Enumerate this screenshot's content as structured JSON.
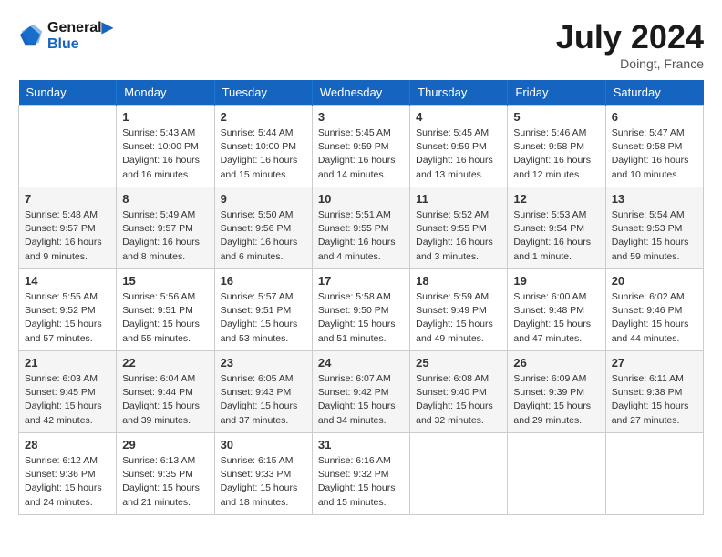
{
  "header": {
    "logo_line1": "General",
    "logo_line2": "Blue",
    "month": "July 2024",
    "location": "Doingt, France"
  },
  "weekdays": [
    "Sunday",
    "Monday",
    "Tuesday",
    "Wednesday",
    "Thursday",
    "Friday",
    "Saturday"
  ],
  "weeks": [
    [
      {
        "day": "",
        "info": ""
      },
      {
        "day": "1",
        "info": "Sunrise: 5:43 AM\nSunset: 10:00 PM\nDaylight: 16 hours\nand 16 minutes."
      },
      {
        "day": "2",
        "info": "Sunrise: 5:44 AM\nSunset: 10:00 PM\nDaylight: 16 hours\nand 15 minutes."
      },
      {
        "day": "3",
        "info": "Sunrise: 5:45 AM\nSunset: 9:59 PM\nDaylight: 16 hours\nand 14 minutes."
      },
      {
        "day": "4",
        "info": "Sunrise: 5:45 AM\nSunset: 9:59 PM\nDaylight: 16 hours\nand 13 minutes."
      },
      {
        "day": "5",
        "info": "Sunrise: 5:46 AM\nSunset: 9:58 PM\nDaylight: 16 hours\nand 12 minutes."
      },
      {
        "day": "6",
        "info": "Sunrise: 5:47 AM\nSunset: 9:58 PM\nDaylight: 16 hours\nand 10 minutes."
      }
    ],
    [
      {
        "day": "7",
        "info": "Sunrise: 5:48 AM\nSunset: 9:57 PM\nDaylight: 16 hours\nand 9 minutes."
      },
      {
        "day": "8",
        "info": "Sunrise: 5:49 AM\nSunset: 9:57 PM\nDaylight: 16 hours\nand 8 minutes."
      },
      {
        "day": "9",
        "info": "Sunrise: 5:50 AM\nSunset: 9:56 PM\nDaylight: 16 hours\nand 6 minutes."
      },
      {
        "day": "10",
        "info": "Sunrise: 5:51 AM\nSunset: 9:55 PM\nDaylight: 16 hours\nand 4 minutes."
      },
      {
        "day": "11",
        "info": "Sunrise: 5:52 AM\nSunset: 9:55 PM\nDaylight: 16 hours\nand 3 minutes."
      },
      {
        "day": "12",
        "info": "Sunrise: 5:53 AM\nSunset: 9:54 PM\nDaylight: 16 hours\nand 1 minute."
      },
      {
        "day": "13",
        "info": "Sunrise: 5:54 AM\nSunset: 9:53 PM\nDaylight: 15 hours\nand 59 minutes."
      }
    ],
    [
      {
        "day": "14",
        "info": "Sunrise: 5:55 AM\nSunset: 9:52 PM\nDaylight: 15 hours\nand 57 minutes."
      },
      {
        "day": "15",
        "info": "Sunrise: 5:56 AM\nSunset: 9:51 PM\nDaylight: 15 hours\nand 55 minutes."
      },
      {
        "day": "16",
        "info": "Sunrise: 5:57 AM\nSunset: 9:51 PM\nDaylight: 15 hours\nand 53 minutes."
      },
      {
        "day": "17",
        "info": "Sunrise: 5:58 AM\nSunset: 9:50 PM\nDaylight: 15 hours\nand 51 minutes."
      },
      {
        "day": "18",
        "info": "Sunrise: 5:59 AM\nSunset: 9:49 PM\nDaylight: 15 hours\nand 49 minutes."
      },
      {
        "day": "19",
        "info": "Sunrise: 6:00 AM\nSunset: 9:48 PM\nDaylight: 15 hours\nand 47 minutes."
      },
      {
        "day": "20",
        "info": "Sunrise: 6:02 AM\nSunset: 9:46 PM\nDaylight: 15 hours\nand 44 minutes."
      }
    ],
    [
      {
        "day": "21",
        "info": "Sunrise: 6:03 AM\nSunset: 9:45 PM\nDaylight: 15 hours\nand 42 minutes."
      },
      {
        "day": "22",
        "info": "Sunrise: 6:04 AM\nSunset: 9:44 PM\nDaylight: 15 hours\nand 39 minutes."
      },
      {
        "day": "23",
        "info": "Sunrise: 6:05 AM\nSunset: 9:43 PM\nDaylight: 15 hours\nand 37 minutes."
      },
      {
        "day": "24",
        "info": "Sunrise: 6:07 AM\nSunset: 9:42 PM\nDaylight: 15 hours\nand 34 minutes."
      },
      {
        "day": "25",
        "info": "Sunrise: 6:08 AM\nSunset: 9:40 PM\nDaylight: 15 hours\nand 32 minutes."
      },
      {
        "day": "26",
        "info": "Sunrise: 6:09 AM\nSunset: 9:39 PM\nDaylight: 15 hours\nand 29 minutes."
      },
      {
        "day": "27",
        "info": "Sunrise: 6:11 AM\nSunset: 9:38 PM\nDaylight: 15 hours\nand 27 minutes."
      }
    ],
    [
      {
        "day": "28",
        "info": "Sunrise: 6:12 AM\nSunset: 9:36 PM\nDaylight: 15 hours\nand 24 minutes."
      },
      {
        "day": "29",
        "info": "Sunrise: 6:13 AM\nSunset: 9:35 PM\nDaylight: 15 hours\nand 21 minutes."
      },
      {
        "day": "30",
        "info": "Sunrise: 6:15 AM\nSunset: 9:33 PM\nDaylight: 15 hours\nand 18 minutes."
      },
      {
        "day": "31",
        "info": "Sunrise: 6:16 AM\nSunset: 9:32 PM\nDaylight: 15 hours\nand 15 minutes."
      },
      {
        "day": "",
        "info": ""
      },
      {
        "day": "",
        "info": ""
      },
      {
        "day": "",
        "info": ""
      }
    ]
  ]
}
